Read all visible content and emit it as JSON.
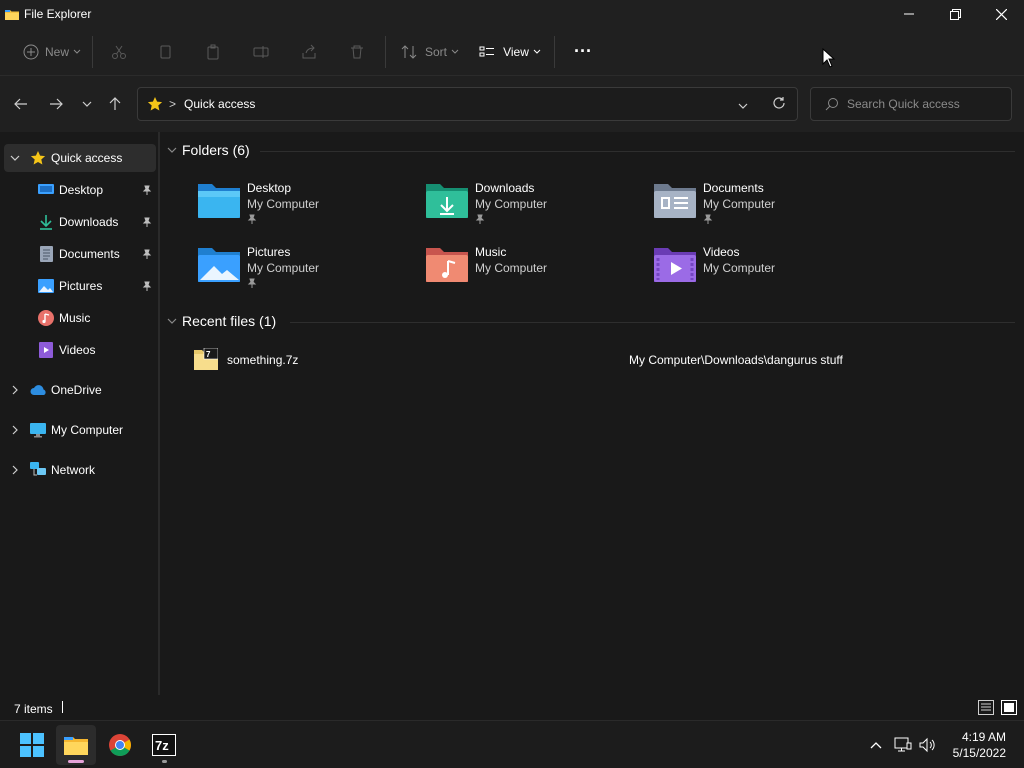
{
  "window": {
    "title": "File Explorer"
  },
  "toolbar": {
    "new_label": "New",
    "sort_label": "Sort",
    "view_label": "View",
    "more_label": "···"
  },
  "address": {
    "location": "Quick access",
    "separator": ">"
  },
  "search": {
    "placeholder": "Search Quick access"
  },
  "sidebar": {
    "items": [
      {
        "label": "Quick access",
        "icon": "star-icon",
        "pinned": false
      },
      {
        "label": "Desktop",
        "icon": "desktop-icon",
        "pinned": true
      },
      {
        "label": "Downloads",
        "icon": "download-icon",
        "pinned": true
      },
      {
        "label": "Documents",
        "icon": "document-icon",
        "pinned": true
      },
      {
        "label": "Pictures",
        "icon": "pictures-icon",
        "pinned": true
      },
      {
        "label": "Music",
        "icon": "music-icon",
        "pinned": false
      },
      {
        "label": "Videos",
        "icon": "videos-icon",
        "pinned": false
      },
      {
        "label": "OneDrive",
        "icon": "cloud-icon",
        "pinned": false
      },
      {
        "label": "My Computer",
        "icon": "computer-icon",
        "pinned": false
      },
      {
        "label": "Network",
        "icon": "network-icon",
        "pinned": false
      }
    ]
  },
  "folders": {
    "header": "Folders (6)",
    "items": [
      {
        "name": "Desktop",
        "location": "My Computer",
        "pinned": true,
        "icon": "desktop-folder-icon"
      },
      {
        "name": "Downloads",
        "location": "My Computer",
        "pinned": true,
        "icon": "downloads-folder-icon"
      },
      {
        "name": "Documents",
        "location": "My Computer",
        "pinned": true,
        "icon": "documents-folder-icon"
      },
      {
        "name": "Pictures",
        "location": "My Computer",
        "pinned": true,
        "icon": "pictures-folder-icon"
      },
      {
        "name": "Music",
        "location": "My Computer",
        "pinned": false,
        "icon": "music-folder-icon"
      },
      {
        "name": "Videos",
        "location": "My Computer",
        "pinned": false,
        "icon": "videos-folder-icon"
      }
    ]
  },
  "recent": {
    "header": "Recent files (1)",
    "items": [
      {
        "name": "something.7z",
        "path": "My Computer\\Downloads\\dangurus stuff",
        "icon": "7z-archive-icon"
      }
    ]
  },
  "status": {
    "item_count": "7 items"
  },
  "taskbar": {
    "apps": [
      "start-icon",
      "file-explorer-icon",
      "chrome-icon",
      "7zip-icon"
    ],
    "time": "4:19 AM",
    "date": "5/15/2022"
  },
  "colors": {
    "background": "#191919",
    "chrome": "#202020",
    "selected": "#2d2d2d",
    "accent": "#4cc2ff"
  }
}
